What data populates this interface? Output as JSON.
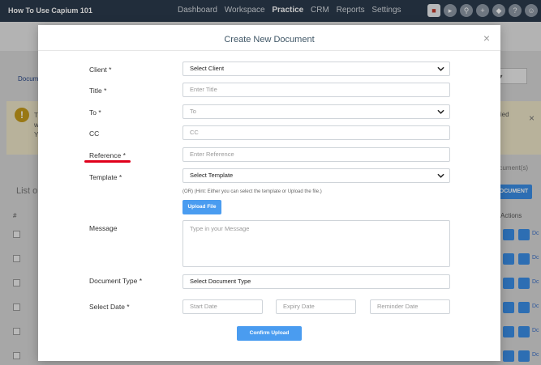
{
  "app": {
    "brand": "How To Use Capium 101",
    "nav": [
      "Dashboard",
      "Workspace",
      "Practice",
      "CRM",
      "Reports",
      "Settings"
    ],
    "nav_active": "Practice",
    "icons": [
      "app-logo-icon",
      "megaphone-icon",
      "search-icon",
      "plus-icon",
      "tag-icon",
      "help-icon",
      "user-icon"
    ]
  },
  "background": {
    "breadcrumb_fragment": "Docum",
    "select_fragment": "e - ▾",
    "warning_fragment": "anied",
    "warning_line_fragments": [
      "T",
      "w",
      "Y"
    ],
    "list_fragment": "List o",
    "hash": "#",
    "documents_fragment": "ocument(s)",
    "doc_button_fragment": "OCUMENT",
    "actions": "Actions",
    "row_link_fragment": "Dc"
  },
  "modal": {
    "title": "Create New Document",
    "client_label": "Client *",
    "client_value": "Select Client",
    "title_label": "Title *",
    "title_placeholder": "Enter Title",
    "to_label": "To *",
    "to_placeholder": "To",
    "cc_label": "CC",
    "cc_placeholder": "CC",
    "reference_label": "Reference *",
    "reference_placeholder": "Enter Reference",
    "template_label": "Template *",
    "template_value": "Select Template",
    "hint": "(OR)  (Hint: Either you can select the template or Upload the file.)",
    "upload_button": "Upload File",
    "message_label": "Message",
    "message_placeholder": "Type in your Message",
    "doc_type_label": "Document Type *",
    "doc_type_value": "Select Document Type",
    "date_label": "Select Date *",
    "start_date_placeholder": "Start Date",
    "expiry_date_placeholder": "Expiry Date",
    "reminder_date_placeholder": "Reminder Date",
    "confirm_button": "Confirm Upload"
  },
  "colors": {
    "topbar": "#2b3a4c",
    "primary_button": "#4a9cf0",
    "annotation_underline": "#e0001b",
    "title_text": "#3f5666"
  }
}
